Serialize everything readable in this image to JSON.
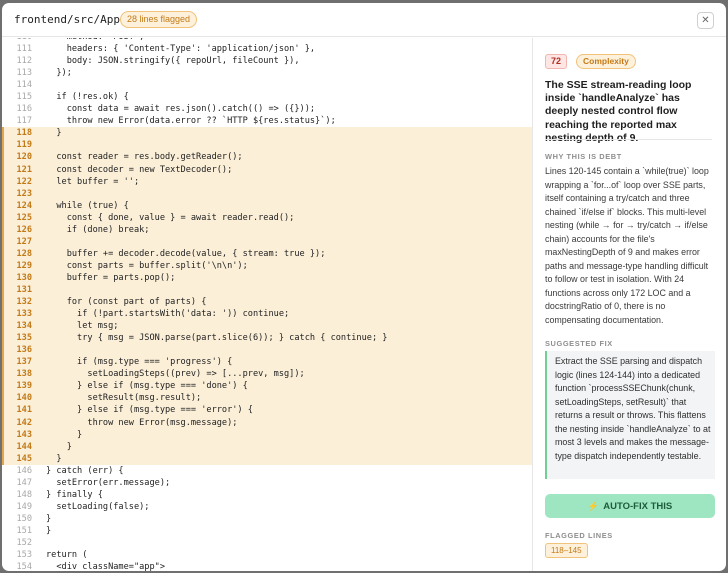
{
  "header": {
    "file_path": "frontend/src/App.jsx",
    "flag_badge": "28 lines flagged",
    "close_glyph": "✕"
  },
  "code": {
    "flagged_range": [
      118,
      145
    ],
    "lines": [
      {
        "n": 110,
        "t": "    method: 'POST',"
      },
      {
        "n": 111,
        "t": "    headers: { 'Content-Type': 'application/json' },"
      },
      {
        "n": 112,
        "t": "    body: JSON.stringify({ repoUrl, fileCount }),"
      },
      {
        "n": 113,
        "t": "  });"
      },
      {
        "n": 114,
        "t": ""
      },
      {
        "n": 115,
        "t": "  if (!res.ok) {"
      },
      {
        "n": 116,
        "t": "    const data = await res.json().catch(() => ({}));"
      },
      {
        "n": 117,
        "t": "    throw new Error(data.error ?? `HTTP ${res.status}`);"
      },
      {
        "n": 118,
        "t": "  }"
      },
      {
        "n": 119,
        "t": ""
      },
      {
        "n": 120,
        "t": "  const reader = res.body.getReader();"
      },
      {
        "n": 121,
        "t": "  const decoder = new TextDecoder();"
      },
      {
        "n": 122,
        "t": "  let buffer = '';"
      },
      {
        "n": 123,
        "t": ""
      },
      {
        "n": 124,
        "t": "  while (true) {"
      },
      {
        "n": 125,
        "t": "    const { done, value } = await reader.read();"
      },
      {
        "n": 126,
        "t": "    if (done) break;"
      },
      {
        "n": 127,
        "t": ""
      },
      {
        "n": 128,
        "t": "    buffer += decoder.decode(value, { stream: true });"
      },
      {
        "n": 129,
        "t": "    const parts = buffer.split('\\n\\n');"
      },
      {
        "n": 130,
        "t": "    buffer = parts.pop();"
      },
      {
        "n": 131,
        "t": ""
      },
      {
        "n": 132,
        "t": "    for (const part of parts) {"
      },
      {
        "n": 133,
        "t": "      if (!part.startsWith('data: ')) continue;"
      },
      {
        "n": 134,
        "t": "      let msg;"
      },
      {
        "n": 135,
        "t": "      try { msg = JSON.parse(part.slice(6)); } catch { continue; }"
      },
      {
        "n": 136,
        "t": ""
      },
      {
        "n": 137,
        "t": "      if (msg.type === 'progress') {"
      },
      {
        "n": 138,
        "t": "        setLoadingSteps((prev) => [...prev, msg]);"
      },
      {
        "n": 139,
        "t": "      } else if (msg.type === 'done') {"
      },
      {
        "n": 140,
        "t": "        setResult(msg.result);"
      },
      {
        "n": 141,
        "t": "      } else if (msg.type === 'error') {"
      },
      {
        "n": 142,
        "t": "        throw new Error(msg.message);"
      },
      {
        "n": 143,
        "t": "      }"
      },
      {
        "n": 144,
        "t": "    }"
      },
      {
        "n": 145,
        "t": "  }"
      },
      {
        "n": 146,
        "t": "} catch (err) {"
      },
      {
        "n": 147,
        "t": "  setError(err.message);"
      },
      {
        "n": 148,
        "t": "} finally {"
      },
      {
        "n": 149,
        "t": "  setLoading(false);"
      },
      {
        "n": 150,
        "t": "}"
      },
      {
        "n": 151,
        "t": "}"
      },
      {
        "n": 152,
        "t": ""
      },
      {
        "n": 153,
        "t": "return ("
      },
      {
        "n": 154,
        "t": "  <div className=\"app\">"
      }
    ]
  },
  "issue": {
    "score": "72",
    "category": "Complexity",
    "headline": "The SSE stream-reading loop inside `handleAnalyze` has deeply nested control flow reaching the reported max nesting depth of 9.",
    "why_label": "WHY THIS IS DEBT",
    "why_text": "Lines 120-145 contain a `while(true)` loop wrapping a `for...of` loop over SSE parts, itself containing a try/catch and three chained `if/else if` blocks. This multi-level nesting (while → for → try/catch → if/else chain) accounts for the file's maxNestingDepth of 9 and makes error paths and message-type handling difficult to follow or test in isolation. With 24 functions across only 172 LOC and a docstringRatio of 0, there is no compensating documentation.",
    "fix_label": "SUGGESTED FIX",
    "fix_text": "Extract the SSE parsing and dispatch logic (lines 124-144) into a dedicated function `processSSEChunk(chunk, setLoadingSteps, setResult)` that returns a result or throws. This flattens the nesting inside `handleAnalyze` to at most 3 levels and makes the message-type dispatch independently testable.",
    "autofix_icon": "⚡",
    "autofix_label": "AUTO-FIX THIS",
    "flagged_lines_label": "FLAGGED LINES",
    "flagged_range_label": "118–145"
  }
}
